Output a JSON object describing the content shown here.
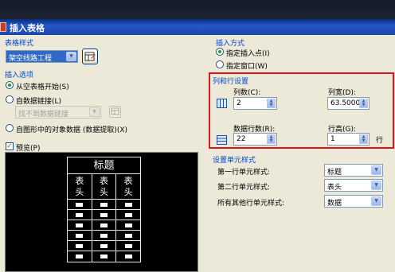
{
  "dialog": {
    "title": "插入表格"
  },
  "table_style": {
    "group_label": "表格样式",
    "selected": "架空线路工程"
  },
  "insert_options": {
    "group_label": "插入选项",
    "options": [
      {
        "label": "从空表格开始(S)",
        "checked": true
      },
      {
        "label": "自数据链接(L)",
        "checked": false
      },
      {
        "label": "自图形中的对象数据 (数据提取)(X)",
        "checked": false
      }
    ],
    "data_link_placeholder": "找不到数据链接"
  },
  "preview": {
    "label": "预览(P)",
    "checked": true,
    "table_title": "标题",
    "header_cells": [
      {
        "line1": "表",
        "line2": "头"
      },
      {
        "line1": "表",
        "line2": "头"
      },
      {
        "line1": "表",
        "line2": "头"
      }
    ],
    "data_rows": 6,
    "data_cols": 3
  },
  "insert_method": {
    "group_label": "插入方式",
    "options": [
      {
        "label": "指定插入点(I)",
        "checked": true
      },
      {
        "label": "指定窗口(W)",
        "checked": false
      }
    ]
  },
  "row_col_settings": {
    "group_label": "列和行设置",
    "columns_label": "列数(C):",
    "columns_value": "2",
    "col_width_label": "列宽(D):",
    "col_width_value": "63.5000",
    "data_rows_label": "数据行数(R):",
    "data_rows_value": "22",
    "row_height_label": "行高(G):",
    "row_height_value": "1",
    "row_height_unit": "行"
  },
  "cell_styles": {
    "group_label": "设置单元样式",
    "first_row_label": "第一行单元样式:",
    "first_row_value": "标题",
    "second_row_label": "第二行单元样式:",
    "second_row_value": "表头",
    "other_rows_label": "所有其他行单元样式:",
    "other_rows_value": "数据"
  },
  "colors": {
    "title_bar": "#2458c8",
    "group_label": "#0046d5",
    "highlight_border": "#d8181f",
    "selection": "#316ac5"
  }
}
